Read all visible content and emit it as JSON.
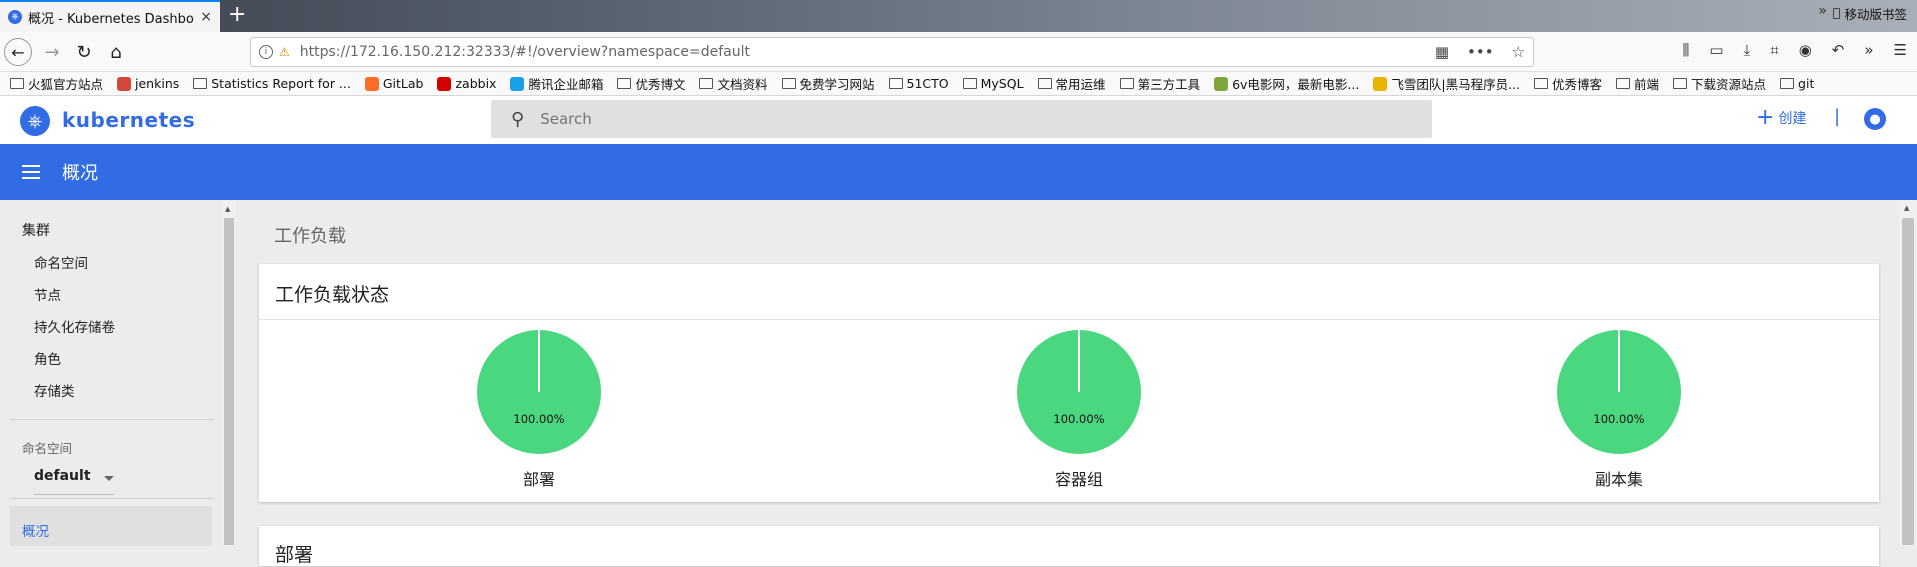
{
  "browser": {
    "tab_title": "概况 - Kubernetes Dashboar",
    "tab_close": "×",
    "new_tab": "+",
    "url_host": "https://172.16.150.212",
    "url_rest": ":32333/#!/overview?namespace=default",
    "bookmarks": [
      {
        "label": "火狐官方站点",
        "icon": "folder-icon"
      },
      {
        "label": "jenkins",
        "icon": "jenkins-icon",
        "color": "#d24939"
      },
      {
        "label": "Statistics Report for ...",
        "icon": "globe-icon"
      },
      {
        "label": "GitLab",
        "icon": "gitlab-icon",
        "color": "#fc6d26"
      },
      {
        "label": "zabbix",
        "icon": "zabbix-icon",
        "color": "#d40000"
      },
      {
        "label": "腾讯企业邮箱",
        "icon": "mail-icon",
        "color": "#1aa0e8"
      },
      {
        "label": "优秀博文",
        "icon": "folder-icon"
      },
      {
        "label": "文档资料",
        "icon": "folder-icon"
      },
      {
        "label": "免费学习网站",
        "icon": "folder-icon"
      },
      {
        "label": "51CTO",
        "icon": "folder-icon"
      },
      {
        "label": "MySQL",
        "icon": "folder-icon"
      },
      {
        "label": "常用运维",
        "icon": "folder-icon"
      },
      {
        "label": "第三方工具",
        "icon": "folder-icon"
      },
      {
        "label": "6v电影网，最新电影...",
        "icon": "film-icon",
        "color": "#7fa63a"
      },
      {
        "label": "飞雪团队|黑马程序员...",
        "icon": "trophy-icon",
        "color": "#e8b400"
      },
      {
        "label": "优秀博客",
        "icon": "folder-icon"
      },
      {
        "label": "前端",
        "icon": "folder-icon"
      },
      {
        "label": "下载资源站点",
        "icon": "folder-icon"
      },
      {
        "label": "git",
        "icon": "folder-icon"
      }
    ],
    "bookmarks_more": "»",
    "mobile_bookmarks": "移动版书签"
  },
  "app": {
    "brand": "kubernetes",
    "search_placeholder": "Search",
    "create_label": "创建",
    "divider": "|",
    "page_title": "概况",
    "accent_color": "#326ce5"
  },
  "sidebar": {
    "cluster_heading": "集群",
    "cluster_items": [
      "命名空间",
      "节点",
      "持久化存储卷",
      "角色",
      "存储类"
    ],
    "namespace_heading": "命名空间",
    "namespace_value": "default",
    "active_item": "概况"
  },
  "main": {
    "section_title": "工作负载",
    "card_title": "工作负载状态",
    "next_card_title": "部署",
    "pies": [
      {
        "label": "部署",
        "percent": "100.00%",
        "fraction": 1.0,
        "color": "#4ad77f"
      },
      {
        "label": "容器组",
        "percent": "100.00%",
        "fraction": 1.0,
        "color": "#4ad77f"
      },
      {
        "label": "副本集",
        "percent": "100.00%",
        "fraction": 1.0,
        "color": "#4ad77f"
      }
    ]
  }
}
